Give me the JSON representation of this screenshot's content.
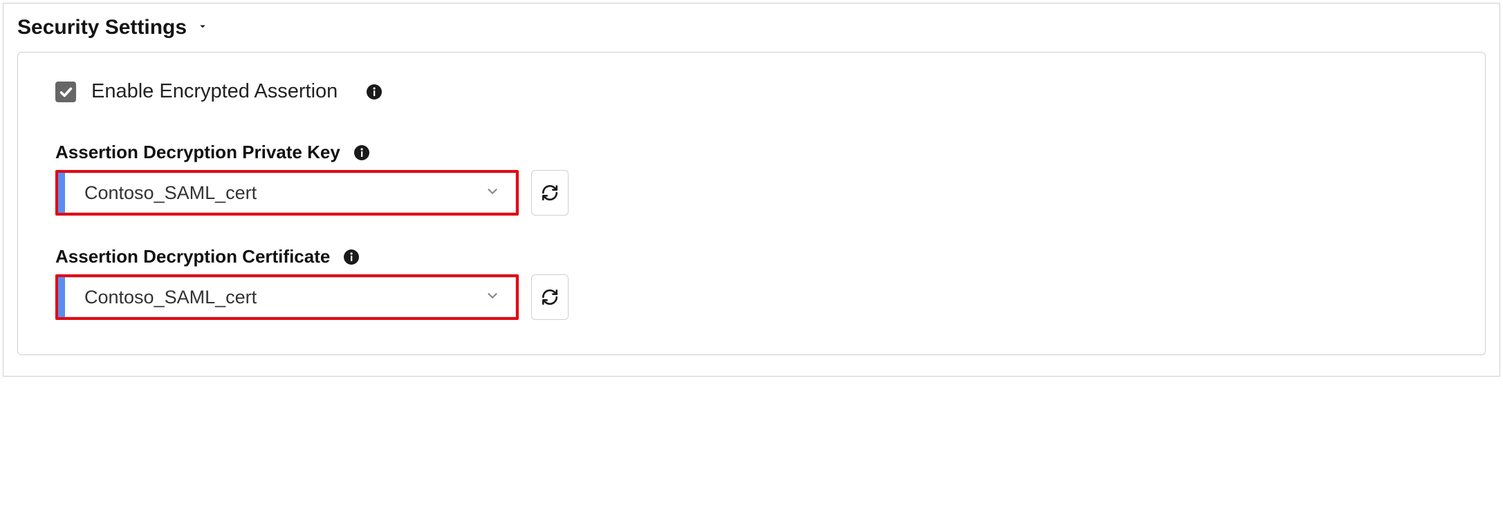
{
  "section": {
    "title": "Security Settings"
  },
  "checkbox": {
    "checked": true,
    "label": "Enable Encrypted Assertion"
  },
  "fields": {
    "privateKey": {
      "label": "Assertion Decryption Private Key",
      "value": "Contoso_SAML_cert"
    },
    "certificate": {
      "label": "Assertion Decryption Certificate",
      "value": "Contoso_SAML_cert"
    }
  }
}
